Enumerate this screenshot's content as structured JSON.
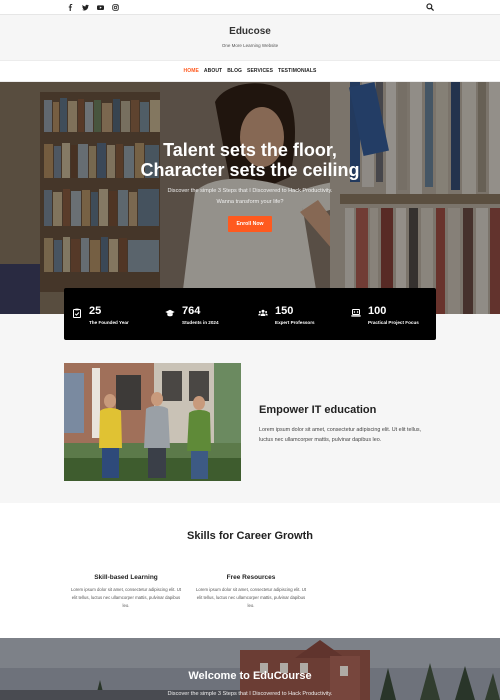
{
  "topbar": {
    "social_icons": [
      "facebook-icon",
      "twitter-icon",
      "youtube-icon",
      "instagram-icon"
    ],
    "search_icon": "search-icon"
  },
  "header": {
    "brand": "Educose",
    "tagline": "One More Learning Website"
  },
  "nav": {
    "items": [
      {
        "label": "HOME",
        "active": true
      },
      {
        "label": "ABOUT",
        "active": false
      },
      {
        "label": "BLOG",
        "active": false
      },
      {
        "label": "SERVICES",
        "active": false
      },
      {
        "label": "TESTIMONIALS",
        "active": false
      }
    ]
  },
  "hero": {
    "title_line1": "Talent sets the floor,",
    "title_line2": "Character sets the ceiling",
    "subtitle_line1": "Discover the simple 3 Steps that I Discovered to Hack Productivity.",
    "subtitle_line2": "Wanna transform your life?",
    "cta": "Enroll Now"
  },
  "stats": [
    {
      "icon": "clipboard-check-icon",
      "number": "25",
      "label": "The Founded Year"
    },
    {
      "icon": "graduation-cap-icon",
      "number": "764",
      "label": "Students in 2024"
    },
    {
      "icon": "users-icon",
      "number": "150",
      "label": "Expert Professors"
    },
    {
      "icon": "laptop-code-icon",
      "number": "100",
      "label": "Practical Project Focus"
    }
  ],
  "empower": {
    "title": "Empower IT education",
    "text": "Lorem ipsum dolor sit amet, consectetur adipiscing elit. Ut elit tellus, luctus nec ullamcorper mattis, pulvinar dapibus leo."
  },
  "skills": {
    "title": "Skills for Career Growth",
    "items": [
      {
        "title": "Skill-based Learning",
        "text": "Lorem ipsum dolor sit amet, consectetur adipiscing elit. Ut elit tellus, luctus nec ullamcorper mattis, pulvinar dapibus leo."
      },
      {
        "title": "Free Resources",
        "text": "Lorem ipsum dolor sit amet, consectetur adipiscing elit. Ut elit tellus, luctus nec ullamcorper mattis, pulvinar dapibus leo."
      }
    ]
  },
  "welcome": {
    "title": "Welcome to EduCourse",
    "subtitle": "Discover the simple 3 Steps that I Discovered to Hack Productivity."
  },
  "colors": {
    "accent": "#ff5a1f",
    "stats_bg": "#000000"
  }
}
